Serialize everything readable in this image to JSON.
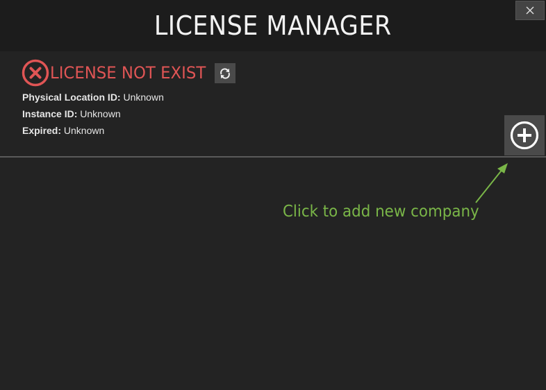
{
  "window": {
    "title": "LICENSE MANAGER"
  },
  "status": {
    "text": "LICENSE NOT EXIST",
    "icon": "x-circle-icon",
    "color": "#e05555"
  },
  "details": [
    {
      "label": "Physical Location ID:",
      "value": "Unknown"
    },
    {
      "label": "Instance ID:",
      "value": "Unknown"
    },
    {
      "label": "Expired:",
      "value": "Unknown"
    }
  ],
  "hint": {
    "text": "Click to add new company",
    "color": "#7ab648"
  },
  "colors": {
    "background": "#232323",
    "titlebar": "#1c1c1c",
    "button": "#4a4a4a"
  }
}
